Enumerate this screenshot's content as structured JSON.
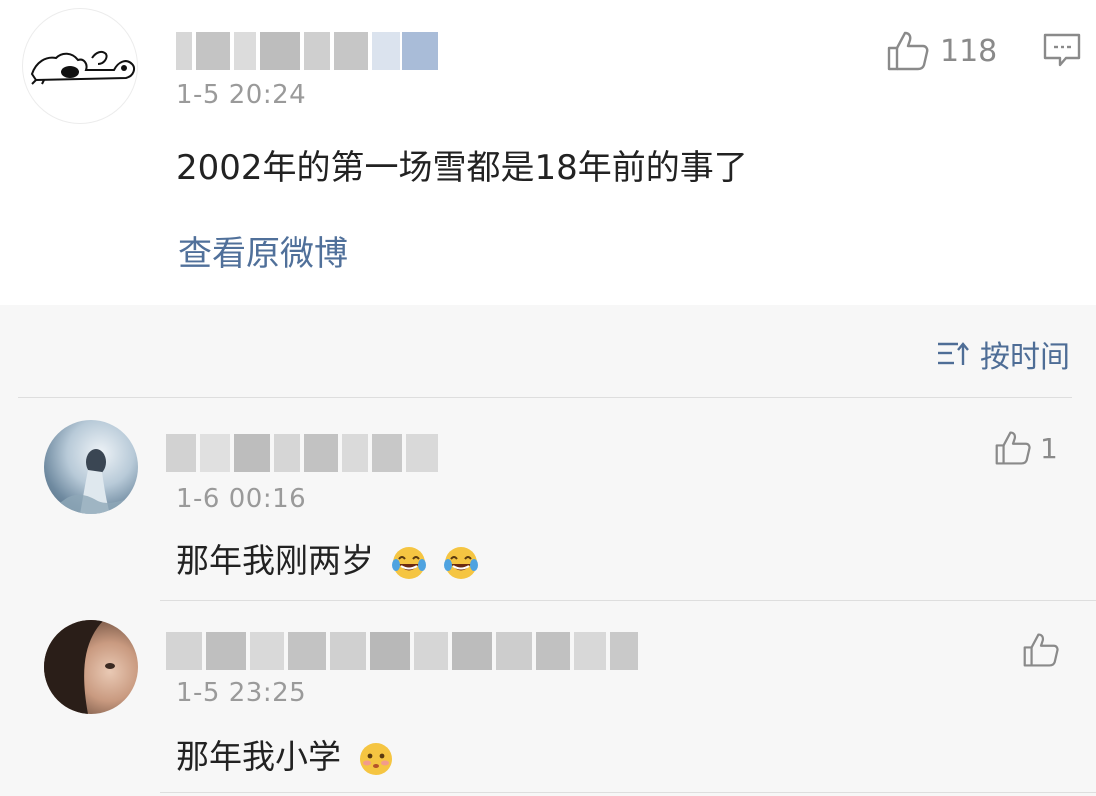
{
  "post": {
    "time": "1-5 20:24",
    "text": "2002年的第一场雪都是18年前的事了",
    "likes": "118",
    "view_original": "查看原微博",
    "icons": [
      "thumbs-up-icon",
      "comment-icon"
    ]
  },
  "sort": {
    "label": "按时间",
    "icon": "sort-icon"
  },
  "comments": [
    {
      "time": "1-6 00:16",
      "text": "那年我刚两岁",
      "likes": "1",
      "emojis": [
        "laugh-cry-emoji",
        "laugh-cry-emoji"
      ]
    },
    {
      "time": "1-5 23:25",
      "text": "那年我小学",
      "likes": "",
      "emojis": [
        "blush-emoji"
      ]
    }
  ],
  "colors": {
    "link": "#50709a",
    "sort": "#4e6d96",
    "meta": "#9a9a9a",
    "bg": "#f7f7f7"
  }
}
